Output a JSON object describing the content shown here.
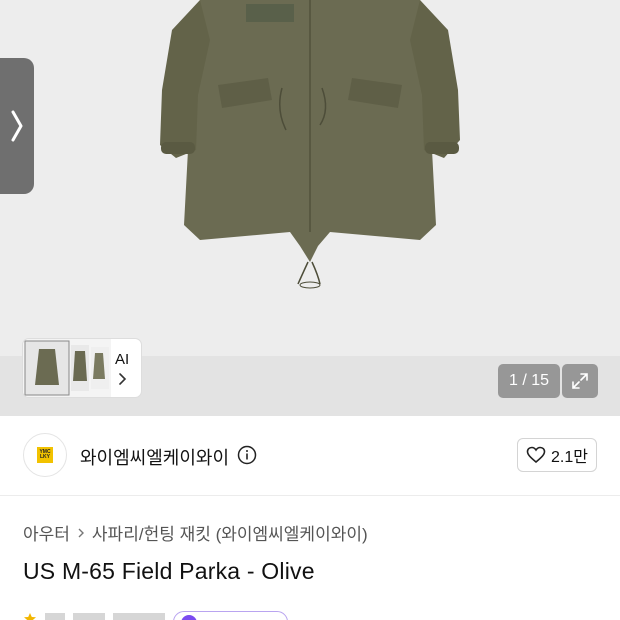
{
  "gallery": {
    "ai_label": "AI",
    "page_counter": "1 / 15"
  },
  "brand": {
    "logo_text": "YMC LKY",
    "name": "와이엠씨엘케이와이",
    "likes": "2.1만"
  },
  "breadcrumb": {
    "category": "아우터",
    "subcategory": "사파리/헌팅 재킷 (와이엠씨엘케이와이)"
  },
  "product": {
    "title": "US M-65 Field Parka - Olive"
  },
  "colors": {
    "parka": "#6b6b52",
    "accent_purple": "#7b4bf0",
    "logo_yellow": "#f2c200"
  },
  "icons": {
    "side_arrow": "chevron-right-icon",
    "thumb_chevron": "chevron-right-icon",
    "expand": "expand-icon",
    "info": "info-icon",
    "like": "heart-icon"
  }
}
